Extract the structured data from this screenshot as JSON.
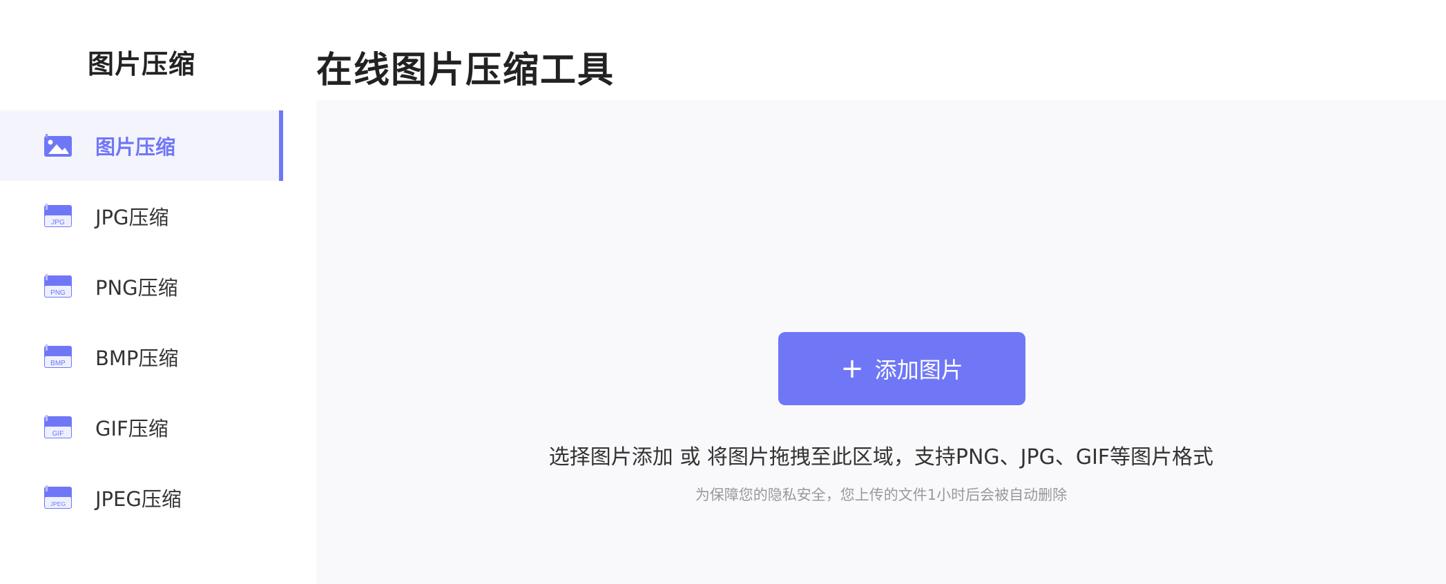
{
  "sidebar": {
    "title": "图片压缩",
    "items": [
      {
        "label": "图片压缩",
        "icon": "image-icon",
        "badge": "",
        "active": true
      },
      {
        "label": "JPG压缩",
        "icon": "jpg-file-icon",
        "badge": "JPG",
        "active": false
      },
      {
        "label": "PNG压缩",
        "icon": "png-file-icon",
        "badge": "PNG",
        "active": false
      },
      {
        "label": "BMP压缩",
        "icon": "bmp-file-icon",
        "badge": "BMP",
        "active": false
      },
      {
        "label": "GIF压缩",
        "icon": "gif-file-icon",
        "badge": "GIF",
        "active": false
      },
      {
        "label": "JPEG压缩",
        "icon": "jpeg-file-icon",
        "badge": "JPEG",
        "active": false
      }
    ]
  },
  "main": {
    "title": "在线图片压缩工具",
    "add_button_label": "添加图片",
    "hint": "选择图片添加 或 将图片拖拽至此区域，支持PNG、JPG、GIF等图片格式",
    "privacy_note": "为保障您的隐私安全，您上传的文件1小时后会被自动删除"
  },
  "colors": {
    "accent": "#6f77f7",
    "active_bg": "#f4f5fc",
    "drop_zone_bg": "#f9f9fc",
    "muted_text": "#999999"
  }
}
